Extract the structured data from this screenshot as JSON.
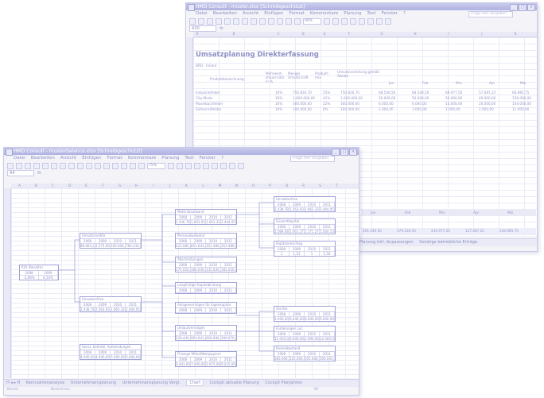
{
  "back_window": {
    "title": "HMD Consult - muster.xlsx [Schreibgeschützt]",
    "menu": [
      "Datei",
      "Bearbeiten",
      "Ansicht",
      "Einfügen",
      "Format",
      "Kommentare",
      "Planung",
      "Text",
      "Fenster",
      "?"
    ],
    "help_placeholder": "Frage hier eingeben",
    "zoom": "90%",
    "name_box": "A30",
    "heading": "Umsatzplanung Direkterfassung",
    "subheading": "BRD - Inland",
    "col_letters": [
      "A",
      "B",
      "C",
      "D",
      "E",
      "F",
      "G",
      "H",
      "I",
      "J",
      "K"
    ],
    "table_headers": [
      "Produktbezeichnung",
      "Mehrwert-steuer-satz in %",
      "Menge/ Umsatz EUR",
      "Produkt-mix",
      "Umsatzverteilung gemäß Absatz",
      "Jan",
      "Feb",
      "Mrz",
      "Apr",
      "Mai"
    ],
    "rows": [
      {
        "name": "Industriefelder",
        "tax": "16%",
        "qty": "750.826,70",
        "mix": "55%",
        "sum": "750.826,70",
        "jan": "68.540,50",
        "feb": "68.540,50",
        "mrz": "68.977,50",
        "apr": "57.687,25",
        "mai": "68.985,75"
      },
      {
        "name": "City-Mode",
        "tax": "16%",
        "qty": "1.000.000,00",
        "mix": "41%",
        "sum": "1.000.000,00",
        "jan": "50.000,00",
        "feb": "50.000,00",
        "mrz": "50.000,00",
        "apr": "49.000,00",
        "mai": "156.000,00"
      },
      {
        "name": "Moselbachfelder",
        "tax": "16%",
        "qty": "300.000,00",
        "mix": "22%",
        "sum": "300.000,00",
        "jan": "6.000,00",
        "feb": "6.000,00",
        "mrz": "15.000,00",
        "apr": "20.000,00",
        "mai": "104.000,00"
      },
      {
        "name": "Seitenreitfelder",
        "tax": "16%",
        "qty": "100.000,00",
        "mix": "8%",
        "sum": "100.000,00",
        "jan": "1.000,00",
        "feb": "1.000,00",
        "mrz": "1.000,00",
        "apr": "1.000,00",
        "mai": "11.000,00"
      }
    ],
    "bottom_months": [
      "Jan",
      "Feb",
      "Mrz",
      "Apr",
      "Mai"
    ],
    "bottom_values": [
      "201.540,50",
      "179.230,50",
      "235.977,50",
      "127.687,25",
      "240.985,75"
    ],
    "tabs": [
      "Planung inkl. Anpassungen",
      "Sonstige betriebliche Erträge"
    ]
  },
  "front_window": {
    "title": "HMD Consult - musterbalance.xlsx [Schreibgeschützt]",
    "menu": [
      "Datei",
      "Bearbeiten",
      "Ansicht",
      "Einfügen",
      "Format",
      "Kommentare",
      "Planung",
      "Text",
      "Fenster",
      "?"
    ],
    "help_placeholder": "Frage hier eingeben",
    "zoom": "75%",
    "name_box": "A4",
    "fx": "fx",
    "col_letters": [
      "A",
      "B",
      "C",
      "D",
      "E",
      "F",
      "G",
      "H",
      "I",
      "J",
      "K",
      "L",
      "M",
      "N",
      "O",
      "P",
      "Q",
      "R",
      "S",
      "T",
      "U"
    ],
    "tabs": [
      "Kennzahlenanalyse",
      "Unternehmensplanung",
      "Unternehmensplanung Vergl.",
      "Chart",
      "Cockpit aktuelle Planung",
      "Cockpit Planjahren"
    ],
    "active_tab": "Chart",
    "nav": "H ◂ ▸ H",
    "status_left": "Bereit",
    "status_mid": "Berechnen",
    "status_right": "NF"
  },
  "diagram": {
    "years": [
      "2008",
      "2009",
      "2010",
      "2011"
    ],
    "nodes": [
      {
        "id": "rok",
        "title": "ROI (Rendite)",
        "values": [
          "2008",
          "2009"
        ],
        "figures": [
          "-2,89%",
          "6,54%"
        ]
      },
      {
        "id": "umsatzrend",
        "title": "Umsatzrendite",
        "figures": [
          "96.665,25",
          "2.575.000",
          "100.000,00",
          "780.234,00"
        ]
      },
      {
        "id": "umsatz",
        "title": "Umsatzerlöse",
        "figures": [
          "2.438.786,75",
          "2.563.934,00",
          "1.663.322,50",
          "2.444.053,75"
        ]
      },
      {
        "id": "mat",
        "title": "Materialaufwand",
        "figures": [
          "2.436.786,75",
          "1.663.934,00",
          "1.663.322,50",
          "2.444.053,75"
        ]
      },
      {
        "id": "pers",
        "title": "Personalaufwand",
        "figures": [
          "222.085,00",
          "851.643,00",
          "352.480,00",
          "352.480,00"
        ]
      },
      {
        "id": "abschr",
        "title": "Abschreibungen",
        "figures": [
          "175.050,00",
          "186.030,00",
          "135.030,00",
          "185.030,00"
        ]
      },
      {
        "id": "sonst",
        "title": "Sonst. betriebl. Aufwendungen",
        "figures": [
          "4.000,00",
          "4.000,00",
          "5.000,00",
          "5.000,00"
        ]
      },
      {
        "id": "kap",
        "title": "Kapitalumschlag",
        "figures": [
          "1",
          "1,53",
          "1",
          "1,50"
        ]
      },
      {
        "id": "umsatz2",
        "title": "Umsatzerlöse",
        "figures": [
          "2.438.786,75",
          "1.563.934,00",
          "1.663.322,50",
          "2.444.053,75"
        ]
      },
      {
        "id": "ges",
        "title": "Gesamtkapital",
        "figures": [
          "1.089.082,25",
          "1.061.279,00",
          "1.171.272,50",
          "1.444.136,00"
        ]
      },
      {
        "id": "lang",
        "title": "Langfristige Kapitalbindung",
        "figures": [
          "",
          "",
          "",
          ""
        ]
      },
      {
        "id": "anl",
        "title": "Anlagevermögen für Eigenkapital",
        "figures": [
          "",
          "",
          "",
          ""
        ]
      },
      {
        "id": "uv",
        "title": "Umlaufvermögen",
        "figures": [
          "528.440,00",
          "993.041,00",
          "628.000,00",
          "300.670,00"
        ]
      },
      {
        "id": "liq",
        "title": "Flüssige Mittel/Wertpapiere",
        "figures": [
          "9.441,00",
          "7.000,00",
          "2.975,00",
          "9.025,00"
        ]
      },
      {
        "id": "vorr",
        "title": "Vorräte",
        "figures": [
          "2.000,00",
          "9.440,00",
          "8.000,00",
          "9.000,00"
        ]
      },
      {
        "id": "ford",
        "title": "Forderungen LuL",
        "figures": [
          "11.000,00",
          "6.600,00",
          "2.990,00",
          "12.000,00"
        ]
      },
      {
        "id": "kasse",
        "title": "Kassenbestand",
        "figures": [
          "185.000,00",
          "525.000,00",
          "505.000,00",
          "500.001,00"
        ]
      }
    ]
  },
  "colors": {
    "accent": "#8d8fc4",
    "border": "#9fa2d6",
    "titlebar": "#aeb1e0"
  }
}
